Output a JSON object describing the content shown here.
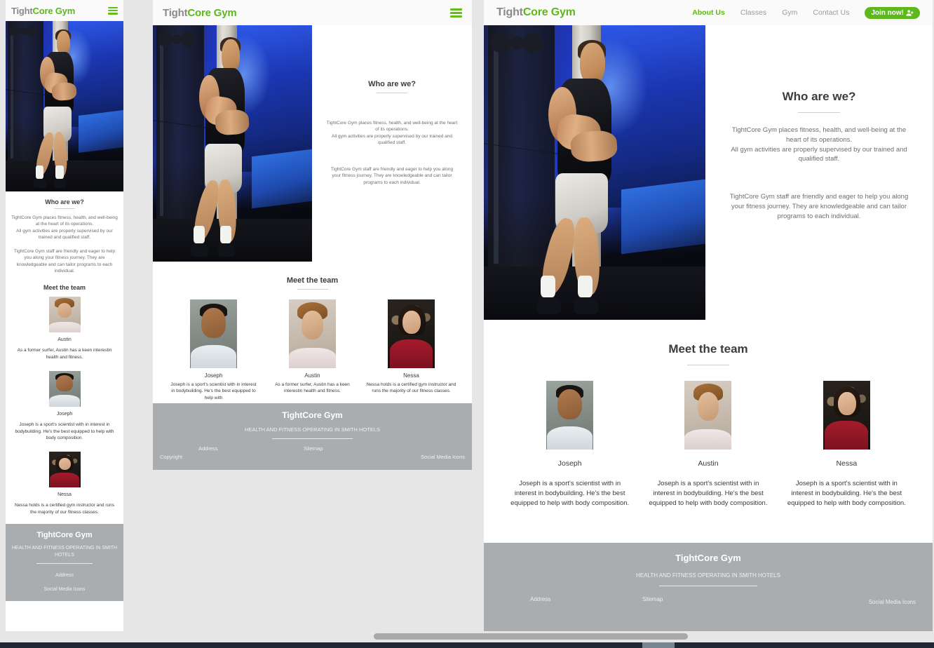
{
  "brand": {
    "part1": "Tight",
    "part2": "Core Gym",
    "full": "TightCore Gym"
  },
  "nav": {
    "hamburger_icon": "hamburger-menu-icon",
    "links": [
      {
        "label": "About Us",
        "active": true
      },
      {
        "label": "Classes",
        "active": false
      },
      {
        "label": "Gym",
        "active": false
      },
      {
        "label": "Contact Us",
        "active": false
      }
    ],
    "join_label": "Join now!",
    "join_icon": "user-plus-icon"
  },
  "hero": {
    "alt": "man-performing-cable-fly-in-gym"
  },
  "about": {
    "title": "Who are we?",
    "paragraph1": "TightCore Gym places fitness, health, and well-being at the heart of its operations.\nAll gym activities are properly supervised by our trained and qualified staff.",
    "paragraph2": "TightCore Gym staff are friendly and eager to help you along your fitness journey. They are knowledgeable and can tailor programs to each individual."
  },
  "team": {
    "title": "Meet the team",
    "desktop_members": [
      {
        "name": "Joseph",
        "bio": "Joseph is a sport's scientist with in interest in bodybuilding. He's the best equipped to help with body composition.",
        "portrait": "joseph-portrait"
      },
      {
        "name": "Austin",
        "bio": "Joseph is a sport's scientist with in interest in bodybuilding. He's the best equipped to help with body composition.",
        "portrait": "austin-portrait"
      },
      {
        "name": "Nessa",
        "bio": "Joseph is a sport's scientist with in interest in bodybuilding. He's the best equipped to help with body composition.",
        "portrait": "nessa-portrait"
      }
    ],
    "tablet_members": [
      {
        "name": "Joseph",
        "bio": "Joseph is a sport's scientist with in interest in bodybuilding. He's the best equipped to help with",
        "portrait": "joseph-portrait"
      },
      {
        "name": "Austin",
        "bio": "As a former surfer, Austin has a keen interestin health and fitness.",
        "portrait": "austin-portrait"
      },
      {
        "name": "Nessa",
        "bio": "Nessa holds is a certified gym instructor and runs the majority of our fitness classes.",
        "portrait": "nessa-portrait"
      }
    ],
    "mobile_members": [
      {
        "name": "Austin",
        "bio": "As a former surfer, Austin has a keen interestin health and fitness.",
        "portrait": "austin-portrait"
      },
      {
        "name": "Joseph",
        "bio": "Joseph is a sport's scientist with in interest in bodybuilding. He's the best equipped to help with body composition.",
        "portrait": "joseph-portrait"
      },
      {
        "name": "Nessa",
        "bio": "Nessa holds is a certified gym instructor and runs the majority of our fitness classes.",
        "portrait": "nessa-portrait"
      }
    ]
  },
  "footer": {
    "brand": "TightCore Gym",
    "tagline": "HEALTH AND FITNESS OPERATING IN SMITH HOTELS",
    "address_label": "Address",
    "sitemap_label": "Sitemap",
    "social_label": "Social Media Icons",
    "copyright_label": "Copyright"
  },
  "colors": {
    "accent_green": "#5cb81b",
    "brand_gray": "#8a8a8a",
    "footer_gray": "#a9adb0",
    "page_bg": "#e6e6e6",
    "taskbar": "#1f2830"
  }
}
